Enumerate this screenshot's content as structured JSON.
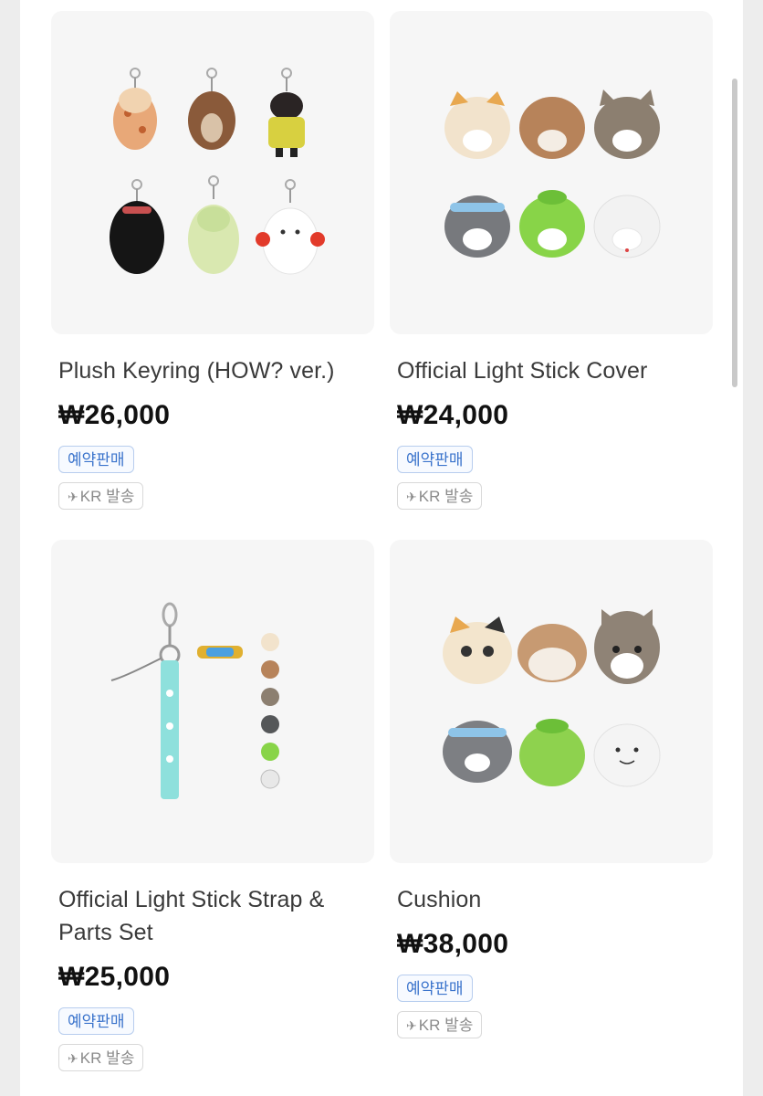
{
  "products": [
    {
      "name": "Plush Keyring (HOW? ver.)",
      "price": "₩26,000",
      "badge_preorder": "예약판매",
      "badge_shipping": "KR 발송",
      "image_icon": "plush-keyring-image"
    },
    {
      "name": "Official Light Stick Cover",
      "price": "₩24,000",
      "badge_preorder": "예약판매",
      "badge_shipping": "KR 발송",
      "image_icon": "light-stick-cover-image"
    },
    {
      "name": "Official Light Stick Strap & Parts Set",
      "price": "₩25,000",
      "badge_preorder": "예약판매",
      "badge_shipping": "KR 발송",
      "image_icon": "light-stick-strap-image"
    },
    {
      "name": "Cushion",
      "price": "₩38,000",
      "badge_preorder": "예약판매",
      "badge_shipping": "KR 발송",
      "image_icon": "cushion-image"
    }
  ],
  "colors": {
    "preorder_text": "#3b74cc",
    "preorder_border": "#b7cdee",
    "ship_text": "#8a8a8a",
    "thumb_bg": "#f6f6f6"
  }
}
